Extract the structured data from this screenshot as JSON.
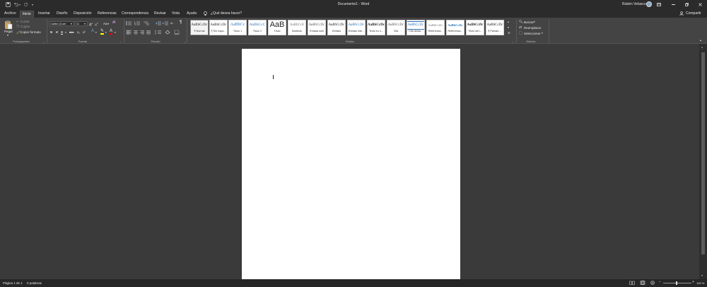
{
  "window": {
    "title": "Documento1  -  Word",
    "user": "Rubén Velasco"
  },
  "quick_access": {
    "save": "save-icon",
    "undo": "undo-icon",
    "redo": "redo-icon",
    "customize": "▾"
  },
  "tabs": [
    {
      "label": "Archivo",
      "active": false
    },
    {
      "label": "Inicio",
      "active": true
    },
    {
      "label": "Insertar",
      "active": false
    },
    {
      "label": "Diseño",
      "active": false
    },
    {
      "label": "Disposición",
      "active": false
    },
    {
      "label": "Referencias",
      "active": false
    },
    {
      "label": "Correspondencia",
      "active": false
    },
    {
      "label": "Revisar",
      "active": false
    },
    {
      "label": "Vista",
      "active": false
    },
    {
      "label": "Ayuda",
      "active": false
    }
  ],
  "tell_me": "¿Qué desea hacer?",
  "share": "Compartir",
  "clipboard": {
    "paste": "Pegar",
    "cut": "Cortar",
    "copy": "Copiar",
    "format_painter": "Copiar formato",
    "group": "Portapapeles"
  },
  "font": {
    "name": "Calibri (Cuer",
    "size": "11",
    "bold": "N",
    "italic": "K",
    "underline": "S",
    "strike": "abc",
    "sub": "x₂",
    "sup": "x²",
    "change_case": "Aa",
    "group": "Fuente"
  },
  "paragraph": {
    "group": "Párrafo",
    "show_marks": "¶"
  },
  "styles": {
    "group": "Estilos",
    "items": [
      {
        "preview": "AaBbCcDc",
        "name": "¶ Normal"
      },
      {
        "preview": "AaBbCcDc",
        "name": "¶ Sin espa..."
      },
      {
        "preview": "AaBbCc",
        "name": "Título 1"
      },
      {
        "preview": "AaBbCcC",
        "name": "Título 2"
      },
      {
        "preview": "AaB",
        "name": "Título"
      },
      {
        "preview": "AaBbCcE",
        "name": "Subtítulo"
      },
      {
        "preview": "AaBbCcDc",
        "name": "Énfasis sutil"
      },
      {
        "preview": "AaBbCcDc",
        "name": "Énfasis"
      },
      {
        "preview": "AaBbCcDc",
        "name": "Énfasis inte..."
      },
      {
        "preview": "AaBbCcDc",
        "name": "Texto en n..."
      },
      {
        "preview": "AaBbCcDc",
        "name": "Cita"
      },
      {
        "preview": "AaBbCcDc",
        "name": "Cita desta..."
      },
      {
        "preview": "AaBbCcDc",
        "name": "Referencia..."
      },
      {
        "preview": "AaBbCcDc",
        "name": "Referencia..."
      },
      {
        "preview": "AaBbCcDc",
        "name": "Título del l..."
      },
      {
        "preview": "AaBbCcDc",
        "name": "¶ Párrafo ..."
      }
    ]
  },
  "editing": {
    "find": "Buscar",
    "replace": "Reemplazar",
    "select": "Seleccionar",
    "group": "Edición"
  },
  "status": {
    "page": "Página 1 de 1",
    "words": "0 palabras",
    "zoom": "100 %"
  },
  "colors": {
    "titlebar": "#2b2b2b",
    "ribbon": "#444444",
    "canvas": "#3a3a3a",
    "page": "#ffffff",
    "highlight": "#ffff00",
    "font_color": "#ff0000"
  }
}
